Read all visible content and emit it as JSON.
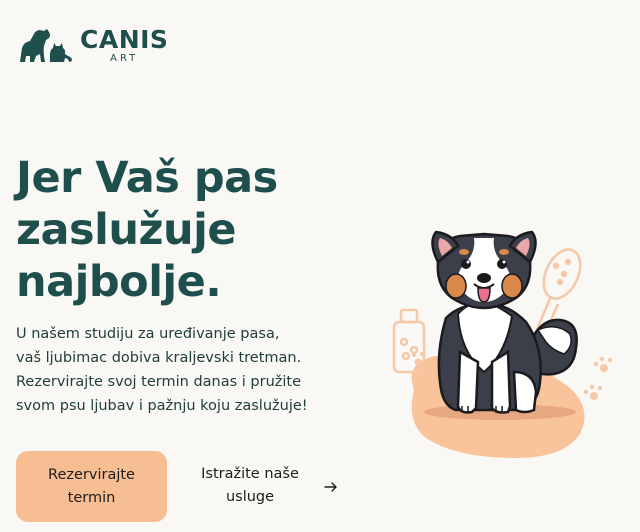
{
  "brand": {
    "name": "CANIS",
    "sub": "ART",
    "color": "#1e4f4c",
    "accent": "#f7bd93"
  },
  "hero": {
    "title_line1": "Jer Vaš pas",
    "title_line2": "zaslužuje",
    "title_line3": "najbolje.",
    "text_line1": "U našem studiju za uređivanje pasa,",
    "text_line2": "vaš ljubimac dobiva kraljevski tretman.",
    "text_line3": "Rezervirajte svoj termin danas i pružite",
    "text_line4": "svom psu ljubav i pažnju koju zaslužuje!"
  },
  "actions": {
    "primary_label": "Rezervirajte termin",
    "secondary_label": "Istražite naše usluge",
    "secondary_icon": "arrow-right-icon"
  },
  "illustration": {
    "icons": [
      "dog-illustration",
      "shampoo-bottle-icon",
      "grooming-brush-icon",
      "paw-print-icon"
    ]
  }
}
